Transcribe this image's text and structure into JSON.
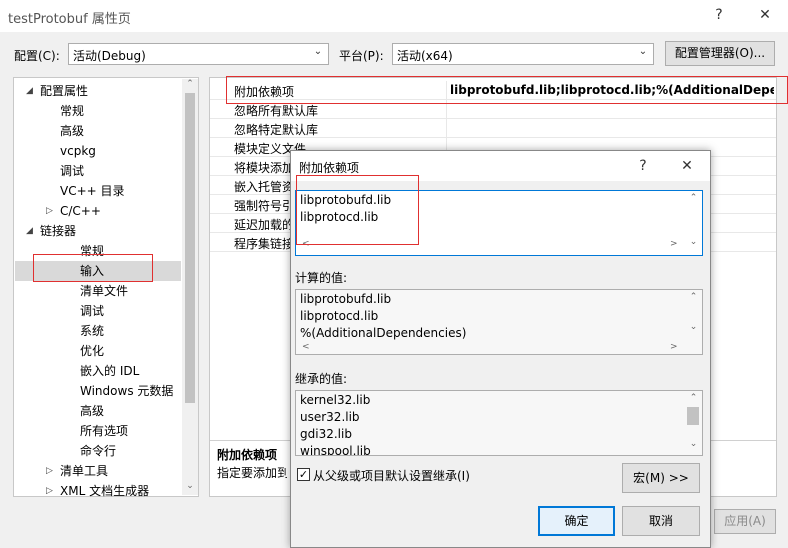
{
  "window": {
    "title": "testProtobuf 属性页",
    "help": "?",
    "close": "✕"
  },
  "toolbar": {
    "config_label": "配置(C):",
    "config_value": "活动(Debug)",
    "platform_label": "平台(P):",
    "platform_value": "活动(x64)",
    "config_manager": "配置管理器(O)..."
  },
  "tree": {
    "items": [
      {
        "label": "配置属性",
        "expander": "◢"
      },
      {
        "label": "常规"
      },
      {
        "label": "高级"
      },
      {
        "label": "vcpkg"
      },
      {
        "label": "调试"
      },
      {
        "label": "VC++ 目录"
      },
      {
        "label": "C/C++",
        "expander": "▷"
      },
      {
        "label": "链接器",
        "expander": "◢"
      },
      {
        "label": "常规"
      },
      {
        "label": "输入"
      },
      {
        "label": "清单文件"
      },
      {
        "label": "调试"
      },
      {
        "label": "系统"
      },
      {
        "label": "优化"
      },
      {
        "label": "嵌入的 IDL"
      },
      {
        "label": "Windows 元数据"
      },
      {
        "label": "高级"
      },
      {
        "label": "所有选项"
      },
      {
        "label": "命令行"
      },
      {
        "label": "清单工具",
        "expander": "▷"
      },
      {
        "label": "XML 文档生成器",
        "expander": "▷"
      }
    ]
  },
  "grid": {
    "rows": [
      {
        "key": "附加依赖项",
        "value": "libprotobufd.lib;libprotocd.lib;%(AdditionalDependencies)"
      },
      {
        "key": "忽略所有默认库",
        "value": ""
      },
      {
        "key": "忽略特定默认库",
        "value": ""
      },
      {
        "key": "模块定义文件",
        "value": ""
      },
      {
        "key": "将模块添加到程序集",
        "value": ""
      },
      {
        "key": "嵌入托管资源文件",
        "value": ""
      },
      {
        "key": "强制符号引用",
        "value": ""
      },
      {
        "key": "延迟加载的 DLL",
        "value": ""
      },
      {
        "key": "程序集链接资源",
        "value": ""
      }
    ],
    "desc_title": "附加依赖项",
    "desc_text": "指定要添加到命令行的附加项"
  },
  "footer": {
    "apply": "应用(A)"
  },
  "dialog": {
    "title": "附加依赖项",
    "help": "?",
    "close": "✕",
    "edit_lines": [
      "libprotobufd.lib",
      "libprotocd.lib"
    ],
    "computed_label": "计算的值:",
    "computed_lines": [
      "libprotobufd.lib",
      "libprotocd.lib",
      "%(AdditionalDependencies)"
    ],
    "inherited_label": "继承的值:",
    "inherited_lines": [
      "kernel32.lib",
      "user32.lib",
      "gdi32.lib",
      "winspool.lib"
    ],
    "inherit_checkbox": "从父级或项目默认设置继承(I)",
    "inherit_checked": true,
    "macro_button": "宏(M) >>",
    "ok_button": "确定",
    "cancel_button": "取消"
  },
  "colors": {
    "selection": "#d9d9d9",
    "highlight_box": "#e03030",
    "accent": "#0078d7"
  }
}
